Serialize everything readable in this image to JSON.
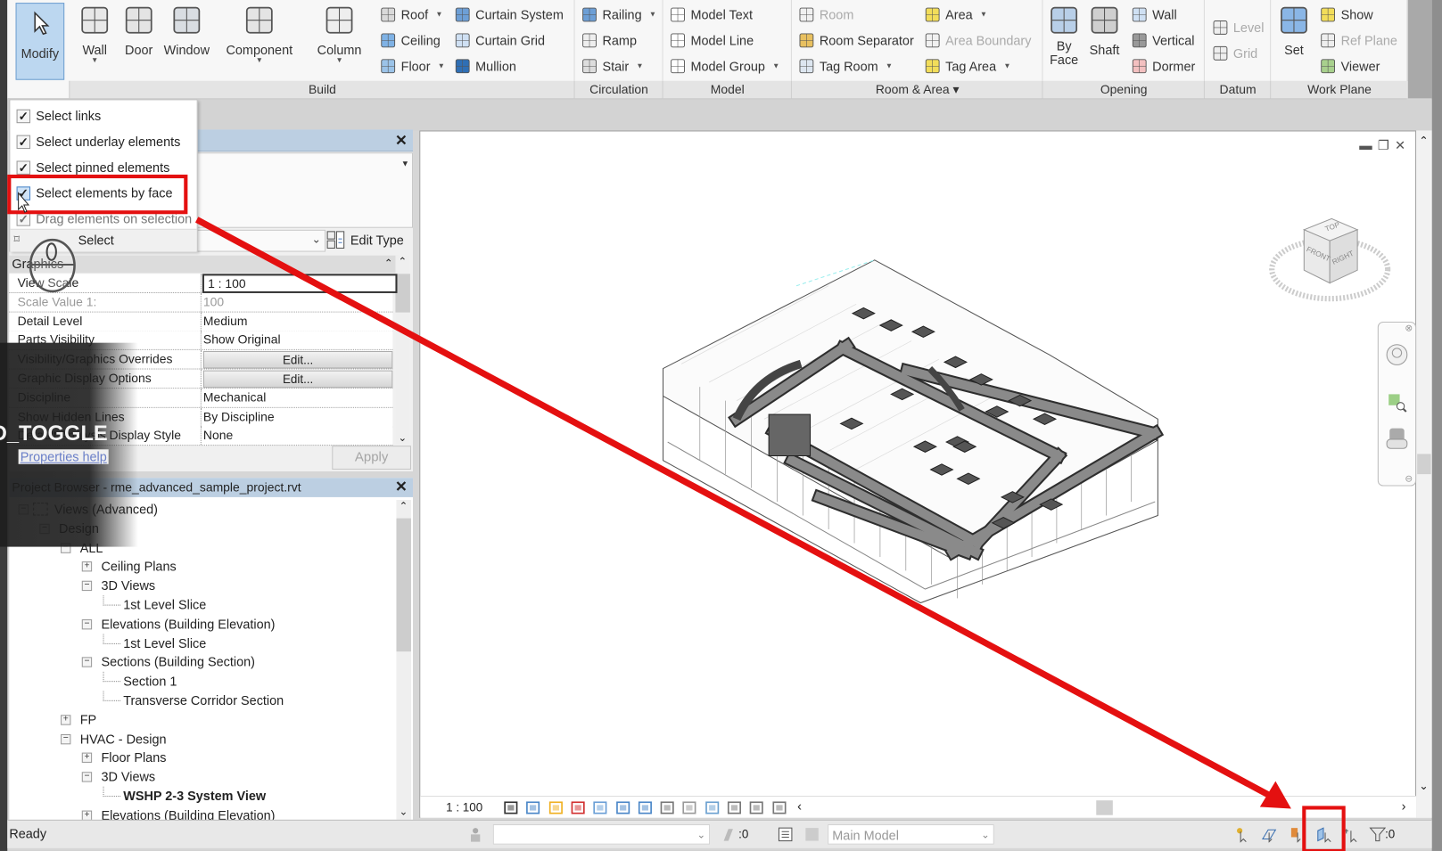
{
  "ribbon": {
    "modify": {
      "label": "Modify",
      "icon": "cursor-arrow-icon"
    },
    "large_buttons": [
      {
        "label": "Wall",
        "icon": "wall-icon",
        "dropdown": true
      },
      {
        "label": "Door",
        "icon": "door-icon",
        "dropdown": false
      },
      {
        "label": "Window",
        "icon": "window-icon",
        "dropdown": false
      },
      {
        "label": "Component",
        "icon": "component-icon",
        "dropdown": true
      },
      {
        "label": "Column",
        "icon": "column-icon",
        "dropdown": true
      },
      {
        "label": "By\nFace",
        "icon": "opening-by-face-icon",
        "dropdown": false
      },
      {
        "label": "Shaft",
        "icon": "shaft-icon",
        "dropdown": false
      },
      {
        "label": "Set",
        "icon": "set-work-plane-icon",
        "dropdown": false
      }
    ],
    "small_columns": [
      [
        {
          "label": "Roof",
          "icon": "roof-icon",
          "dropdown": true
        },
        {
          "label": "Ceiling",
          "icon": "ceiling-icon"
        },
        {
          "label": "Floor",
          "icon": "floor-icon",
          "dropdown": true
        }
      ],
      [
        {
          "label": "Curtain System",
          "icon": "curtain-system-icon"
        },
        {
          "label": "Curtain Grid",
          "icon": "curtain-grid-icon"
        },
        {
          "label": "Mullion",
          "icon": "mullion-icon"
        }
      ],
      [
        {
          "label": "Railing",
          "icon": "railing-icon",
          "dropdown": true
        },
        {
          "label": "Ramp",
          "icon": "ramp-icon"
        },
        {
          "label": "Stair",
          "icon": "stair-icon",
          "dropdown": true
        }
      ],
      [
        {
          "label": "Model Text",
          "icon": "model-text-icon"
        },
        {
          "label": "Model Line",
          "icon": "model-line-icon"
        },
        {
          "label": "Model Group",
          "icon": "model-group-icon",
          "dropdown": true
        }
      ],
      [
        {
          "label": "Room",
          "icon": "room-icon",
          "disabled": true
        },
        {
          "label": "Room Separator",
          "icon": "room-separator-icon"
        },
        {
          "label": "Tag Room",
          "icon": "tag-room-icon",
          "dropdown": true
        }
      ],
      [
        {
          "label": "Area",
          "icon": "area-icon",
          "dropdown": true
        },
        {
          "label": "Area Boundary",
          "icon": "area-boundary-icon",
          "disabled": true
        },
        {
          "label": "Tag Area",
          "icon": "tag-area-icon",
          "dropdown": true
        }
      ],
      [
        {
          "label": "Wall",
          "icon": "wall-opening-icon"
        },
        {
          "label": "Vertical",
          "icon": "vertical-opening-icon"
        },
        {
          "label": "Dormer",
          "icon": "dormer-icon"
        }
      ],
      [
        {
          "label": "Level",
          "icon": "level-icon",
          "disabled": true
        },
        {
          "label": "Grid",
          "icon": "grid-icon",
          "disabled": true
        }
      ],
      [
        {
          "label": "Show",
          "icon": "show-work-plane-icon"
        },
        {
          "label": "Ref Plane",
          "icon": "ref-plane-icon",
          "disabled": true
        },
        {
          "label": "Viewer",
          "icon": "viewer-icon"
        }
      ]
    ],
    "panels": [
      {
        "label": "Build"
      },
      {
        "label": "Circulation"
      },
      {
        "label": "Model"
      },
      {
        "label": "Room & Area ▾"
      },
      {
        "label": "Opening"
      },
      {
        "label": "Datum"
      },
      {
        "label": "Work Plane"
      }
    ]
  },
  "select_menu": {
    "items": [
      {
        "label": "Select links",
        "checked": true
      },
      {
        "label": "Select underlay elements",
        "checked": true
      },
      {
        "label": "Select pinned elements",
        "checked": true
      },
      {
        "label": "Select elements by face",
        "checked": true
      },
      {
        "label": "Drag elements on selection",
        "checked": true
      }
    ],
    "select_label": "Select"
  },
  "properties": {
    "edit_type": "Edit Type",
    "section": "Graphics",
    "rows": [
      {
        "name": "View Scale",
        "value": "1 : 100",
        "kind": "input"
      },
      {
        "name": "Scale Value    1:",
        "value": "100",
        "kind": "dim"
      },
      {
        "name": "Detail Level",
        "value": "Medium"
      },
      {
        "name": "Parts Visibility",
        "value": "Show Original"
      },
      {
        "name": "Visibility/Graphics Overrides",
        "value": "Edit...",
        "kind": "button"
      },
      {
        "name": "Graphic Display Options",
        "value": "Edit...",
        "kind": "button"
      },
      {
        "name": "Discipline",
        "value": "Mechanical"
      },
      {
        "name": "Show Hidden Lines",
        "value": "By Discipline"
      },
      {
        "name": "Default Analysis Display Style",
        "value": "None"
      }
    ],
    "help": "Properties help",
    "apply": "Apply"
  },
  "browser": {
    "title": "Project Browser - rme_advanced_sample_project.rvt",
    "items": [
      {
        "label": "Views (Advanced)",
        "level": 0,
        "exp": "-"
      },
      {
        "label": "Design",
        "level": 1,
        "exp": "-"
      },
      {
        "label": "ALL",
        "level": 2,
        "exp": "-"
      },
      {
        "label": "Ceiling Plans",
        "level": 3,
        "exp": "+"
      },
      {
        "label": "3D Views",
        "level": 3,
        "exp": "-"
      },
      {
        "label": "1st Level Slice",
        "level": 4
      },
      {
        "label": "Elevations (Building Elevation)",
        "level": 3,
        "exp": "-"
      },
      {
        "label": "1st Level Slice",
        "level": 4
      },
      {
        "label": "Sections (Building Section)",
        "level": 3,
        "exp": "-"
      },
      {
        "label": "Section 1",
        "level": 4
      },
      {
        "label": "Transverse Corridor Section",
        "level": 4
      },
      {
        "label": "FP",
        "level": 2,
        "exp": "+"
      },
      {
        "label": "HVAC - Design",
        "level": 2,
        "exp": "-"
      },
      {
        "label": "Floor Plans",
        "level": 3,
        "exp": "+"
      },
      {
        "label": "3D Views",
        "level": 3,
        "exp": "-"
      },
      {
        "label": "WSHP 2-3 System View",
        "level": 4,
        "bold": true
      },
      {
        "label": "Elevations (Building Elevation)",
        "level": 3,
        "exp": "+"
      }
    ]
  },
  "overlay": {
    "toggle_text": "D_TOGGLE"
  },
  "viewport": {
    "scale": "1 : 100",
    "viewcube": {
      "top": "TOP",
      "front": "FRONT",
      "right": "RIGHT"
    }
  },
  "status": {
    "ready": "Ready",
    "count_left": ":0",
    "model": "Main Model",
    "filter_count": ":0"
  },
  "colors": {
    "highlight_red": "#e41010",
    "modify_blue": "#bcd7f0",
    "title_blue": "#bccfe2"
  }
}
